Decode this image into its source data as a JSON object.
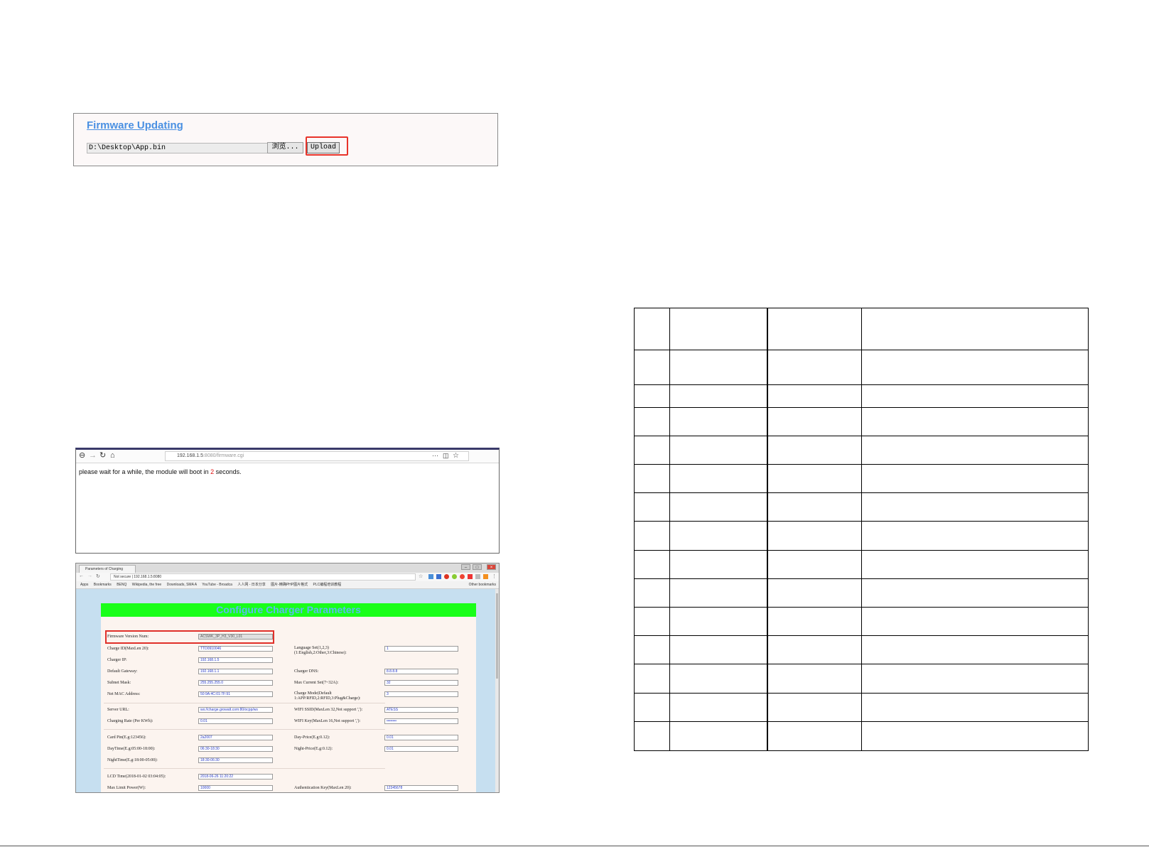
{
  "firmware": {
    "title": "Firmware Updating",
    "file_path": "D:\\Desktop\\App.bin",
    "browse_label": "浏览...",
    "upload_label": "Upload"
  },
  "wait_browser": {
    "url_host": "192.168.1.5",
    "url_rest": ":8080/firmware.cgi",
    "message_before": "please wait for a while, the module will boot in ",
    "countdown": "2",
    "message_after": " seconds."
  },
  "config_browser": {
    "tab_title": "Parameters of Charging",
    "url": "Not secure | 192.168.1.5:8080",
    "bookmarks": [
      "Apps",
      "Bookmarks",
      "BENQ",
      "Wikipedia, the free",
      "Downloads, SMA A",
      "YouTube - Broadca",
      "人人网 - 日本分享",
      "图片-精确PHP图片格式",
      "PLC编程培训教程",
      "Other bookmarks"
    ],
    "header": "Configure Charger Parameters",
    "fields": {
      "firmware_version": {
        "label": "Firmware Version Num:",
        "value": "ACSWK_3P_H3_V30_L01"
      },
      "charge_id": {
        "label": "Charge ID(MaxLen 20):",
        "value": "TTD0910046"
      },
      "charger_ip": {
        "label": "Charger IP:",
        "value": "192.168.1.5"
      },
      "default_gateway": {
        "label": "Default Gateway:",
        "value": "192.168.1.1"
      },
      "subnet_mask": {
        "label": "Subnet Mask:",
        "value": "255.255.255.0"
      },
      "net_mac": {
        "label": "Net MAC Address:",
        "value": "50:9A:4C:01:7F:91"
      },
      "server_url": {
        "label": "Server URL:",
        "value": "ws://charge.growatt.com:80/ocpp/ws"
      },
      "charging_rate": {
        "label": "Charging Rate (Per KWh):",
        "value": "0.01"
      },
      "card_pin": {
        "label": "Card Pin(E.g:123456):",
        "value": "2a2007"
      },
      "day_time": {
        "label": "DayTime(E.g:05:00-18:00):",
        "value": "06:30-18:30"
      },
      "night_time": {
        "label": "NightTime(E.g:18:00-05:00):",
        "value": "18:30-06:30"
      },
      "lcd_time": {
        "label": "LCD Time(2018-01-02 03:04:05):",
        "value": "2018-06-26 11:20:22"
      },
      "max_limit_power": {
        "label": "Max Limit Power(W):",
        "value": "10000"
      },
      "language_set": {
        "label": "Language Set(1,2,3)",
        "label2": "(1:English,2:Other,3:Chinese):",
        "value": "1"
      },
      "charger_dns": {
        "label": "Charger DNS:",
        "value": "8.8.8.8"
      },
      "max_current": {
        "label": "Max Current Set(7~32A):",
        "value": "32"
      },
      "charge_mode": {
        "label": "Charge Mode(Default",
        "label2": "1:APP/RFID,2:RFID,3:Plug&Charge):",
        "value": "3"
      },
      "wifi_ssid": {
        "label": "WIFI SSID(MaxLen 32,Not support ','):",
        "value": "ATESS"
      },
      "wifi_key": {
        "label": "WIFI Key(MaxLen 16,Not support ','):",
        "value": "••••••••"
      },
      "day_price": {
        "label": "Day-Price(E.g:0.12):",
        "value": "0.01"
      },
      "night_price": {
        "label": "Night-Price(E.g:0.12):",
        "value": "0.01"
      },
      "auth_key": {
        "label": "Authentication Key(MaxLen 20):",
        "value": "12345678"
      }
    }
  },
  "table": {
    "row_count": 15
  }
}
